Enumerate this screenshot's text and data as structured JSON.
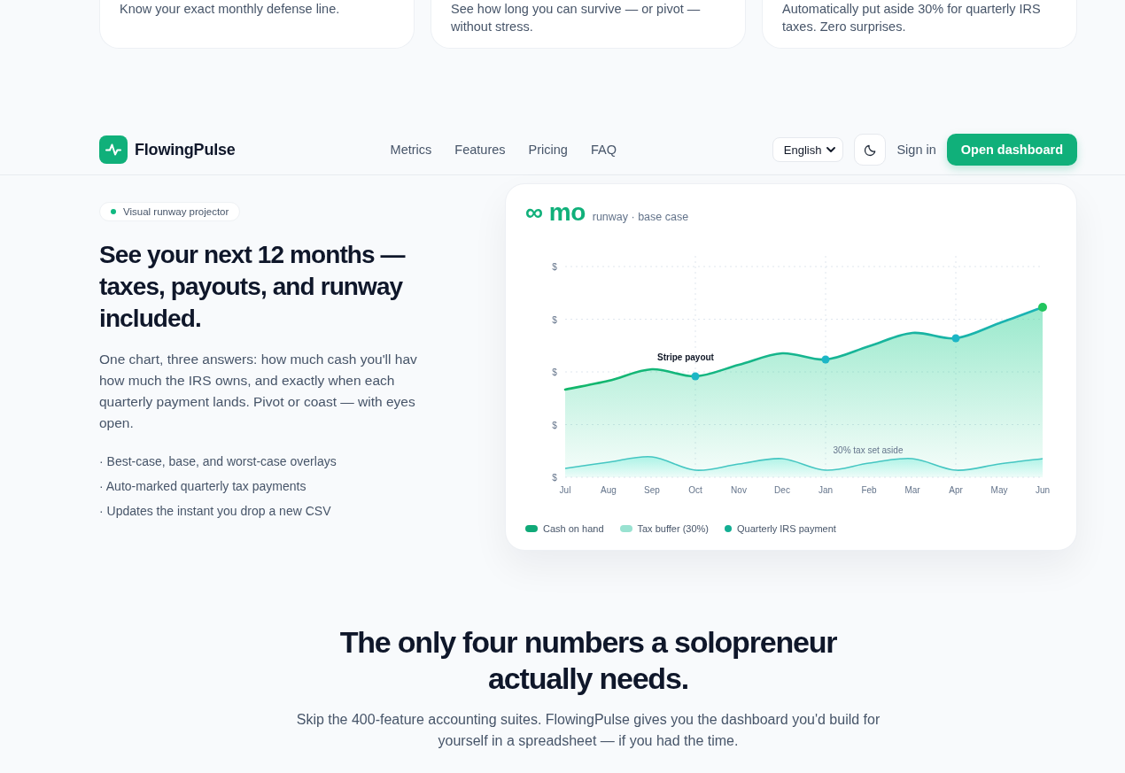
{
  "feature_cards": [
    {
      "text": "Know your exact monthly defense line."
    },
    {
      "text": "See how long you can survive — or pivot — without stress."
    },
    {
      "text": "Automatically put aside 30% for quarterly IRS taxes. Zero surprises."
    }
  ],
  "nav": {
    "brand": "FlowingPulse",
    "links": [
      "Metrics",
      "Features",
      "Pricing",
      "FAQ"
    ],
    "language": "English",
    "sign_in": "Sign in",
    "cta": "Open dashboard"
  },
  "hero": {
    "badge": "Visual runway projector",
    "heading": "See your next 12 months — taxes, payouts, and runway included.",
    "body": "One chart, three answers: how much cash you'll hav how much the IRS owns, and exactly when each quarterly payment lands. Pivot or coast — with eyes open.",
    "bullets": [
      "· Best-case, base, and worst-case overlays",
      "· Auto-marked quarterly tax payments",
      "· Updates the instant you drop a new CSV"
    ]
  },
  "runway_card": {
    "value": "∞ mo",
    "caption": "runway · base case",
    "chart": {
      "y_labels": [
        "$",
        "$",
        "$",
        "$",
        "$"
      ],
      "x_labels": [
        "Jul",
        "Aug",
        "Sep",
        "Oct",
        "Nov",
        "Dec",
        "Jan",
        "Feb",
        "Mar",
        "Apr",
        "May",
        "Jun"
      ],
      "annotations": [
        {
          "kind": "event",
          "text": "Stripe payout"
        },
        {
          "kind": "band",
          "text": "30% tax set aside"
        }
      ]
    },
    "legend": [
      {
        "kind": "swatch",
        "label": "Cash on hand",
        "color": "#10a978"
      },
      {
        "kind": "swatch",
        "label": "Tax buffer (30%)",
        "color": "#99e2d1"
      },
      {
        "kind": "dot",
        "label": "Quarterly IRS payment",
        "color": "#13ae93"
      }
    ]
  },
  "section": {
    "heading": "The only four numbers a solopreneur actually needs.",
    "body": "Skip the 400-feature accounting suites. FlowingPulse gives you the dashboard you'd build for yourself in a spreadsheet — if you had the time."
  }
}
